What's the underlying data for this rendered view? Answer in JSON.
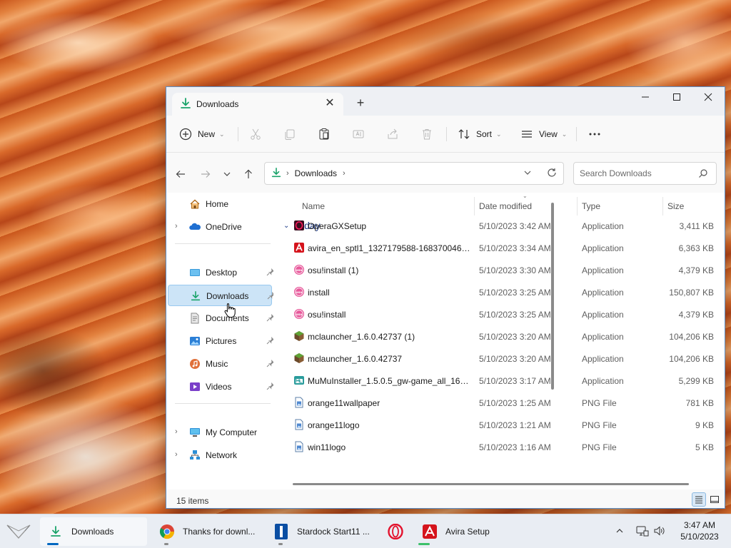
{
  "window": {
    "tab_title": "Downloads",
    "new_tab": "+"
  },
  "toolbar": {
    "new_label": "New",
    "sort_label": "Sort",
    "view_label": "View",
    "more_label": "..."
  },
  "address": {
    "folder": "Downloads"
  },
  "search": {
    "placeholder": "Search Downloads"
  },
  "sidebar": {
    "items": [
      {
        "label": "Home",
        "icon": "home-icon"
      },
      {
        "label": "OneDrive",
        "icon": "onedrive-icon"
      },
      {
        "label": "Desktop",
        "icon": "desktop-icon"
      },
      {
        "label": "Downloads",
        "icon": "download-icon"
      },
      {
        "label": "Documents",
        "icon": "documents-icon"
      },
      {
        "label": "Pictures",
        "icon": "pictures-icon"
      },
      {
        "label": "Music",
        "icon": "music-icon"
      },
      {
        "label": "Videos",
        "icon": "videos-icon"
      },
      {
        "label": "My Computer",
        "icon": "computer-icon"
      },
      {
        "label": "Network",
        "icon": "network-icon"
      }
    ]
  },
  "columns": {
    "name": "Name",
    "date": "Date modified",
    "type": "Type",
    "size": "Size"
  },
  "group": {
    "title": "Today"
  },
  "files": [
    {
      "name": "OperaGXSetup",
      "date": "5/10/2023 3:42 AM",
      "type": "Application",
      "size": "3,411 KB",
      "icon": "opera-gx-icon"
    },
    {
      "name": "avira_en_sptl1_1327179588-1683700462__...",
      "date": "5/10/2023 3:34 AM",
      "type": "Application",
      "size": "6,363 KB",
      "icon": "avira-icon"
    },
    {
      "name": "osu!install (1)",
      "date": "5/10/2023 3:30 AM",
      "type": "Application",
      "size": "4,379 KB",
      "icon": "osu-icon"
    },
    {
      "name": "install",
      "date": "5/10/2023 3:25 AM",
      "type": "Application",
      "size": "150,807 KB",
      "icon": "osu-icon"
    },
    {
      "name": "osu!install",
      "date": "5/10/2023 3:25 AM",
      "type": "Application",
      "size": "4,379 KB",
      "icon": "osu-icon"
    },
    {
      "name": "mclauncher_1.6.0.42737 (1)",
      "date": "5/10/2023 3:20 AM",
      "type": "Application",
      "size": "104,206 KB",
      "icon": "minecraft-icon"
    },
    {
      "name": "mclauncher_1.6.0.42737",
      "date": "5/10/2023 3:20 AM",
      "type": "Application",
      "size": "104,206 KB",
      "icon": "minecraft-icon"
    },
    {
      "name": "MuMuInstaller_1.5.0.5_gw-game_all_1663...",
      "date": "5/10/2023 3:17 AM",
      "type": "Application",
      "size": "5,299 KB",
      "icon": "mumu-icon"
    },
    {
      "name": "orange11wallpaper",
      "date": "5/10/2023 1:25 AM",
      "type": "PNG File",
      "size": "781 KB",
      "icon": "png-file-icon"
    },
    {
      "name": "orange11logo",
      "date": "5/10/2023 1:21 AM",
      "type": "PNG File",
      "size": "9 KB",
      "icon": "png-file-icon"
    },
    {
      "name": "win11logo",
      "date": "5/10/2023 1:16 AM",
      "type": "PNG File",
      "size": "5 KB",
      "icon": "png-file-icon"
    }
  ],
  "status": {
    "items_count": "15 items"
  },
  "taskbar": {
    "tasks": [
      {
        "label": "Downloads",
        "icon": "download-icon"
      },
      {
        "label": "Thanks for downl...",
        "icon": "chrome-icon"
      },
      {
        "label": "Stardock Start11 ...",
        "icon": "start11-icon"
      },
      {
        "label": "",
        "icon": "opera-icon"
      },
      {
        "label": "Avira Setup",
        "icon": "avira-icon"
      }
    ],
    "time": "3:47 AM",
    "date": "5/10/2023"
  },
  "colors": {
    "accent": "#0067c0",
    "selected": "#cce4f7",
    "group_header": "#1f3c88",
    "avira_red": "#d5141c",
    "osu_pink": "#e7599b",
    "download_green": "#1aa36a"
  }
}
